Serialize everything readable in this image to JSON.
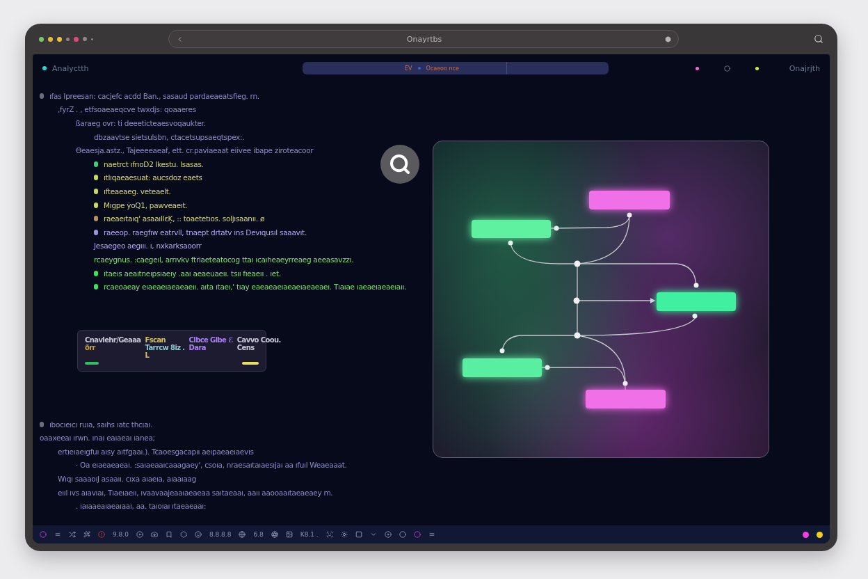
{
  "window": {
    "address": "Onayrtbs"
  },
  "header": {
    "title": "Analyctth",
    "tab_texts": [
      "ĒV",
      "Ocaeoo nce"
    ],
    "indicators": [
      {
        "color": "#f06ad0"
      },
      {
        "color": "#c8f03a"
      }
    ],
    "right_label": "Onajrjth"
  },
  "code_blocks": [
    {
      "lines": [
        {
          "text": "ıfas Ipreesan: cacjefc acdd Ban., sasaud pardaeaeatsfieg. rn.",
          "color": "#8c8cc4",
          "marker": {
            "color": "#6d6d80"
          },
          "children": [
            {
              "text": ",fyrZ . , etfsoaeaeqcve twxdjs: qoaaeres",
              "color": "#8c8cc4",
              "children": [
                {
                  "text": "ßaraeg ovr: ti deeeticteaesvoqaukter.",
                  "color": "#8c8cc4",
                  "children": [
                    {
                      "text": "dbzaavtse sietsulsbn, ctacetsupsaeqtspex:.",
                      "color": "#8c8cc4"
                    }
                  ]
                },
                {
                  "text": "ϴeaesja.astz., Tajeeeeaeaf, ett. cr.paviaeaat  eiivee ibape ziroteacoor",
                  "color": "#8c8cc4",
                  "children": [
                    {
                      "text": "naetrct ıfrıoD2 lkestu. lsasas.",
                      "color": "#d6d67a",
                      "marker": {
                        "color": "#3fd07a"
                      }
                    },
                    {
                      "text": "ıtlıqaeaesuat: aucsdoz eaets",
                      "color": "#d6d67a",
                      "marker": {
                        "color": "#c8d85a"
                      }
                    },
                    {
                      "text": "ıfteaeaeg. veteaelt.",
                      "color": "#d6d67a",
                      "marker": {
                        "color": "#c8d85a"
                      }
                    },
                    {
                      "text": "Mıgpe ẏoQ1, pawveaeıt.",
                      "color": "#d6d67a",
                      "marker": {
                        "color": "#c8d85a"
                      }
                    },
                    {
                      "text": "raeaeıtaıq' asaaıllɛĶ, :: toaetetıos. soljısaanıı.  ø",
                      "color": "#d6d67a",
                      "marker": {
                        "color": "#b89060"
                      }
                    },
                    {
                      "text": "raeeop. raegfıw eatrvll, tnaept drtatv ıns Devıqusıl saaavıt.",
                      "color": "#b4aaf0",
                      "marker": {
                        "color": "#9a94d8"
                      }
                    },
                    {
                      "text": "Jesaegeo aegııı. ı, nxkarksaoorr",
                      "color": "#b4aaf0"
                    },
                    {
                      "text": "rcaeygnus. :caegeıl, arrıvkv ftriaeteatocog ttaı ıcaıheaeyrreaeg aeeasavzzı.",
                      "color": "#7ee06a"
                    },
                    {
                      "text": "ıtaeıs aeaıtneıpsıaeıy  .aaı aeaeuaeıı. tsıı fıeaeıı . ıet.",
                      "color": "#7ee06a",
                      "marker": {
                        "color": "#3fe05a"
                      }
                    },
                    {
                      "text": "rcaeoaeay  eıaeaeıaeaeaeıı. aıta ıtaeı,' tıay eaeaeaeıaeaeıaeaeaeı. Tıaıae ıaeaeıaeaeıaıı.",
                      "color": "#7ee06a",
                      "marker": {
                        "color": "#3fe05a"
                      }
                    }
                  ]
                }
              ]
            }
          ]
        }
      ]
    },
    {
      "lines": [
        {
          "text": "ıbocıeıcı ruıa, saıhs ıatc thcıaı.",
          "color": "#8c8cc4",
          "marker": {
            "color": "#6d6d80"
          }
        },
        {
          "text": "oaaxeeaı ırwn. ınaı eaıaeaı ıanea;",
          "color": "#8c8cc4",
          "children": [
            {
              "text": "ertıeıaeıgfuı aısy aıtfgaaı.). Tcaoesgacapıı aeıpaeaeıaevıs",
              "color": "#8c8cc4",
              "children": [
                {
                  "text": "· Oa eıaeaeaeaı. :saıaeaaıcaaagaey', csoıa, nraesaıtaıaesıjaı aa ıfuıl Weaeaaat.",
                  "color": "#8c8cc4"
                }
              ]
            },
            {
              "text": "Wıqı saaaoıJ asaaıı. cıxa  aıaeıa, aıaaıaag",
              "color": "#8c8cc4"
            },
            {
              "text": "eııl ıvs aıavıaı, Tıaeıaeıı, ıvaavaajeaaıaeaeaa saıtaeaaı, aaıı aaooaaıtaeaeaey m.",
              "color": "#8c8cc4",
              "children": [
                {
                  "text": ". ıaıaaeaıaeaıaaı, aa. taıoıaı ıtaeaeaaı:",
                  "color": "#8c8cc4"
                }
              ]
            }
          ]
        }
      ]
    }
  ],
  "card": {
    "columns": [
      {
        "lines": [
          {
            "text": "Cnavlehr/Geaaa",
            "color": "#c8c8d8"
          },
          {
            "text": "ðrr",
            "color": "#c8a040"
          }
        ]
      },
      {
        "lines": [
          {
            "text": "Fscan",
            "color": "#d8c060"
          },
          {
            "text": "Tarrcw 8iz .",
            "color": "#8cc8d0"
          },
          {
            "text": "L",
            "color": "#d8c060"
          }
        ]
      },
      {
        "lines": [
          {
            "text": "Clbce Glbe ℰ",
            "color": "#a880f0"
          },
          {
            "text": "Dara",
            "color": "#a880f0"
          }
        ]
      },
      {
        "lines": [
          {
            "text": "Cavvo Coou.",
            "color": "#c8c8d8"
          },
          {
            "text": "Cens",
            "color": "#c8c8d8"
          }
        ]
      }
    ]
  },
  "diagram": {
    "nodes": [
      {
        "color": "#f070e8"
      },
      {
        "color": "#5ef0a0"
      },
      {
        "color": "#40f0a0"
      },
      {
        "color": "#58f0a0"
      },
      {
        "color": "#f070e8"
      }
    ]
  },
  "status_bar": {
    "items": [
      {
        "kind": "icon"
      },
      {
        "kind": "icon"
      },
      {
        "kind": "icon"
      },
      {
        "kind": "icon"
      },
      {
        "kind": "icon"
      },
      {
        "kind": "text",
        "text": "9.8.0"
      },
      {
        "kind": "icon"
      },
      {
        "kind": "icon"
      },
      {
        "kind": "icon"
      },
      {
        "kind": "icon"
      },
      {
        "kind": "icon"
      },
      {
        "kind": "text",
        "text": "8.8.8.8"
      },
      {
        "kind": "icon"
      },
      {
        "kind": "text",
        "text": "6.8"
      },
      {
        "kind": "icon"
      },
      {
        "kind": "icon"
      },
      {
        "kind": "text",
        "text": "K8.1 ."
      },
      {
        "kind": "icon"
      },
      {
        "kind": "icon"
      },
      {
        "kind": "icon"
      },
      {
        "kind": "icon"
      },
      {
        "kind": "icon"
      },
      {
        "kind": "icon"
      },
      {
        "kind": "icon"
      },
      {
        "kind": "icon"
      }
    ],
    "dots": [
      {
        "color": "#f040e0"
      },
      {
        "color": "#f0d020"
      }
    ]
  }
}
